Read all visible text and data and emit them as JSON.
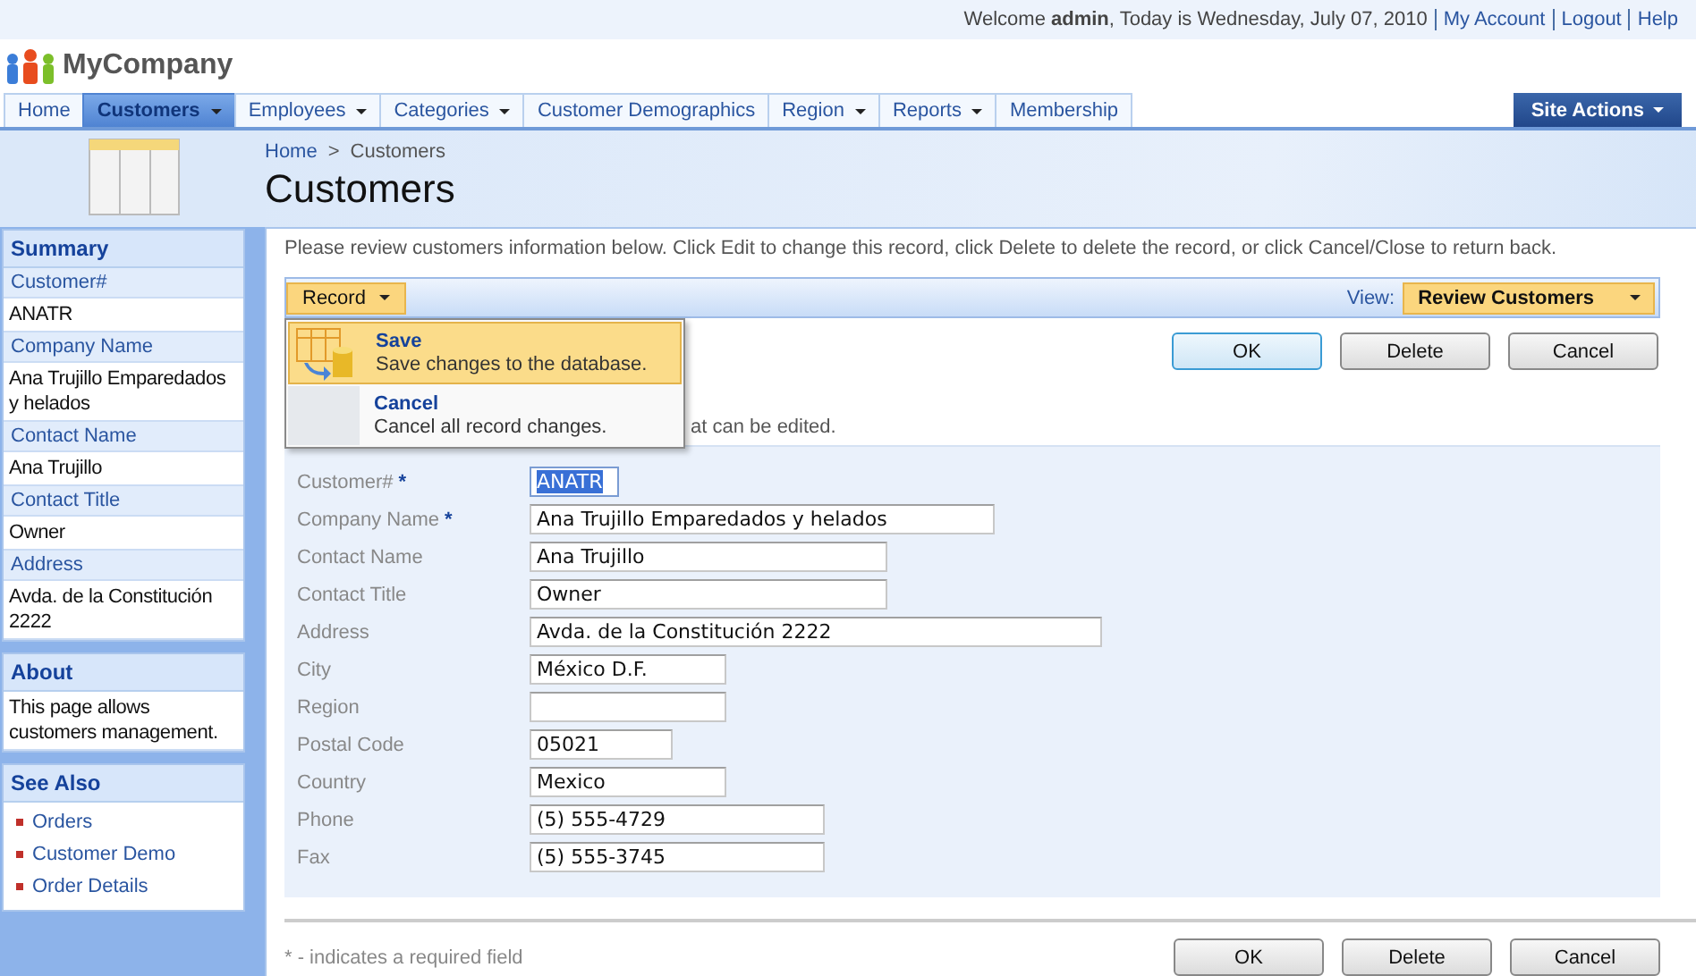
{
  "top_bar": {
    "welcome": "Welcome **admin**, Today is Wednesday, July 07, 2010",
    "links": [
      "My Account",
      "Logout",
      "Help"
    ]
  },
  "brand": "MyCompany",
  "nav": [
    {
      "label": "Home",
      "selected": false,
      "has_menu": false
    },
    {
      "label": "Customers",
      "selected": true,
      "has_menu": true
    },
    {
      "label": "Employees",
      "selected": false,
      "has_menu": true
    },
    {
      "label": "Categories",
      "selected": false,
      "has_menu": true
    },
    {
      "label": "Customer Demographics",
      "selected": false,
      "has_menu": false
    },
    {
      "label": "Region",
      "selected": false,
      "has_menu": true
    },
    {
      "label": "Reports",
      "selected": false,
      "has_menu": true
    },
    {
      "label": "Membership",
      "selected": false,
      "has_menu": false
    }
  ],
  "site_actions": "Site Actions",
  "breadcrumb": [
    "Home",
    "Customers"
  ],
  "breadcrumb_separator": ">",
  "page_title": "Customers",
  "summary": {
    "title": "Summary",
    "items": [
      {
        "label": "Customer#",
        "value": "ANATR"
      },
      {
        "label": "Company Name",
        "value": "Ana Trujillo Emparedados y helados"
      },
      {
        "label": "Contact Name",
        "value": "Ana Trujillo"
      },
      {
        "label": "Contact Title",
        "value": "Owner"
      },
      {
        "label": "Address",
        "value": "Avda. de la Constitución 2222"
      }
    ]
  },
  "about": {
    "title": "About",
    "text": "This page allows customers management."
  },
  "see_also": {
    "title": "See Also",
    "links": [
      "Orders",
      "Customer Demo",
      "Order Details"
    ]
  },
  "instructions": "Please review customers information below. Click Edit to change this record, click Delete to delete the record, or click Cancel/Close to return back.",
  "toolbar": {
    "menu": "Record",
    "view_label": "View:",
    "view": "Review Customers"
  },
  "record_menu": [
    {
      "title": "Save",
      "description": "Save changes to the database.",
      "selected": true
    },
    {
      "title": "Cancel",
      "description": "Cancel all record changes.",
      "selected": false
    }
  ],
  "hidden_note": "at can be edited.",
  "buttons": [
    "OK",
    "Delete",
    "Cancel"
  ],
  "fields": [
    {
      "label": "Customer#",
      "required": true,
      "value": "ANATR",
      "selected": true
    },
    {
      "label": "Company Name",
      "required": true,
      "value": "Ana Trujillo Emparedados y helados",
      "selected": false
    },
    {
      "label": "Contact Name",
      "required": false,
      "value": "Ana Trujillo",
      "selected": false
    },
    {
      "label": "Contact Title",
      "required": false,
      "value": "Owner",
      "selected": false
    },
    {
      "label": "Address",
      "required": false,
      "value": "Avda. de la Constitución 2222",
      "selected": false
    },
    {
      "label": "City",
      "required": false,
      "value": "México D.F.",
      "selected": false
    },
    {
      "label": "Region",
      "required": false,
      "selected": false
    },
    {
      "label": "Postal Code",
      "required": false,
      "value": "05021",
      "selected": false
    },
    {
      "label": "Country",
      "required": false,
      "value": "Mexico",
      "selected": false
    },
    {
      "label": "Phone",
      "required": false,
      "value": "(5) 555-4729",
      "selected": false
    },
    {
      "label": "Fax",
      "required": false,
      "value": "(5) 555-3745",
      "selected": false
    }
  ],
  "required_mark": "*",
  "footnote": "* - indicates a required field",
  "bottom_buttons": [
    "OK",
    "Delete",
    "Cancel"
  ]
}
